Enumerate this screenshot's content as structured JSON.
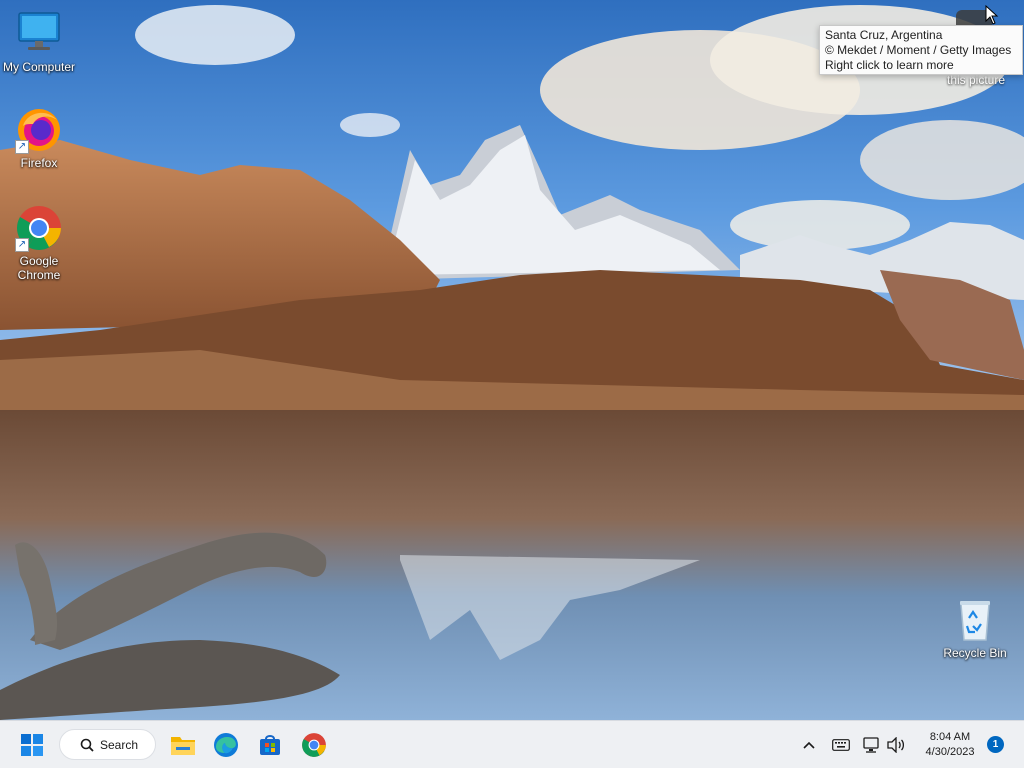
{
  "desktop": {
    "icons": [
      {
        "label": "My Computer",
        "icon": "monitor-icon"
      },
      {
        "label": "Firefox",
        "icon": "firefox-icon"
      },
      {
        "label": "Google Chrome",
        "icon": "chrome-icon"
      },
      {
        "label": "Recycle Bin",
        "icon": "recycle-bin-icon"
      }
    ]
  },
  "spotlight": {
    "tooltip_line1": "Santa Cruz, Argentina",
    "tooltip_line2": "© Mekdet / Moment / Getty Images",
    "tooltip_line3": "Right click to learn more",
    "learn_label": "this picture"
  },
  "taskbar": {
    "search_label": "Search",
    "apps": [
      "start-icon",
      "file-explorer-icon",
      "edge-icon",
      "store-icon",
      "chrome-icon"
    ],
    "tray": {
      "time": "8:04 AM",
      "date": "4/30/2023",
      "notifications": "1"
    }
  },
  "colors": {
    "taskbar_bg": "#eef0f3",
    "accent": "#0067c0"
  }
}
